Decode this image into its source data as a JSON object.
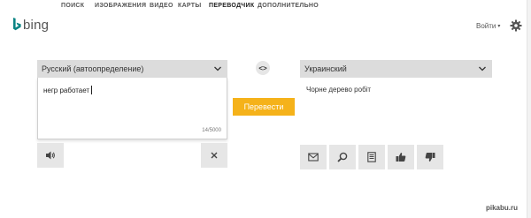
{
  "nav": {
    "items": [
      {
        "label": "ПОИСК",
        "active": false
      },
      {
        "label": "ИЗОБРАЖЕНИЯ",
        "active": false
      },
      {
        "label": "ВИДЕО",
        "active": false
      },
      {
        "label": "КАРТЫ",
        "active": false
      },
      {
        "label": "ПЕРЕВОДЧИК",
        "active": true
      },
      {
        "label": "ДОПОЛНИТЕЛЬНО",
        "active": false
      }
    ]
  },
  "header": {
    "logo_text": "bing",
    "signin_label": "Войти",
    "signin_caret": "▾",
    "settings_icon": "gear-icon"
  },
  "source": {
    "language": "Русский (автоопределение)",
    "text": "негр работает",
    "counter": "14/5000",
    "speak_icon": "speaker-icon",
    "clear_icon": "close-icon"
  },
  "swap": {
    "label": "<>"
  },
  "translate_button": {
    "label": "Перевести"
  },
  "target": {
    "language": "Украинский",
    "text": "Чорне дерево робіт",
    "actions": [
      "mail-icon",
      "search-icon",
      "document-icon",
      "thumbs-up-icon",
      "thumbs-down-icon"
    ]
  },
  "watermark": {
    "text": "pikabu.ru"
  },
  "colors": {
    "accent": "#f5b21a",
    "select_bg": "#dcdcdc",
    "button_bg": "#e6e6e6",
    "logo": "#0c8484"
  }
}
